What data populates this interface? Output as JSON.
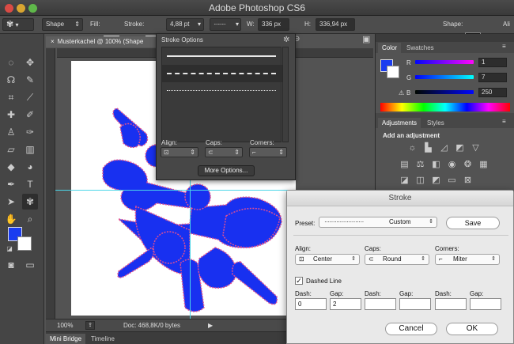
{
  "app": {
    "title": "Adobe Photoshop CS6"
  },
  "options_bar": {
    "mode": "Shape",
    "fill_label": "Fill:",
    "stroke_label": "Stroke:",
    "stroke_width": "4,88 pt",
    "w_label": "W:",
    "w_value": "336 px",
    "h_label": "H:",
    "h_value": "336,94 px",
    "shape_label": "Shape:",
    "fill_color": "#1a3cf0",
    "stroke_color": "#e060a8"
  },
  "document": {
    "tab_title": "Musterkachel @ 100% (Shape",
    "zoom": "100%",
    "doc_info": "Doc: 468,8K/0 bytes",
    "shape_color": "#1830f0",
    "guide_color": "#4bd5e8"
  },
  "bottom_tabs": [
    "Mini Bridge",
    "Timeline"
  ],
  "stroke_options_popup": {
    "title": "Stroke Options",
    "align_label": "Align:",
    "caps_label": "Caps:",
    "corners_label": "Corners:",
    "more_options": "More Options..."
  },
  "color_panel": {
    "tabs": [
      "Color",
      "Swatches"
    ],
    "r_label": "R",
    "g_label": "G",
    "b_label": "B",
    "r_value": "1",
    "g_value": "7",
    "b_value": "250"
  },
  "adjustments_panel": {
    "tabs": [
      "Adjustments",
      "Styles"
    ],
    "heading": "Add an adjustment"
  },
  "stroke_dialog": {
    "title": "Stroke",
    "preset_label": "Preset:",
    "preset_value": "Custom",
    "save": "Save",
    "align_label": "Align:",
    "align_value": "Center",
    "caps_label": "Caps:",
    "caps_value": "Round",
    "corners_label": "Corners:",
    "corners_value": "Miter",
    "dashed_line_label": "Dashed Line",
    "dashed_line_checked": true,
    "dash_gap_labels": [
      "Dash:",
      "Gap:",
      "Dash:",
      "Gap:",
      "Dash:",
      "Gap:"
    ],
    "dash_gap_values": [
      "0",
      "2",
      "",
      "",
      "",
      ""
    ],
    "cancel": "Cancel",
    "ok": "OK"
  }
}
